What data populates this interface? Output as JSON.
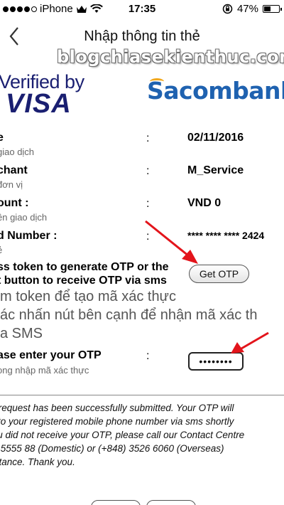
{
  "status_bar": {
    "carrier": "iPhone",
    "time": "17:35",
    "battery_percent": "47%",
    "battery_level": 0.47,
    "signal_dots_filled": 4,
    "signal_dots_total": 5
  },
  "nav": {
    "title": "Nhập thông tin thẻ",
    "watermark": "blogchiasekienthuc.com"
  },
  "logos": {
    "visa_line1": "Verified by",
    "visa_line2": "VISA",
    "bank": "Sacombank"
  },
  "form": {
    "rows": [
      {
        "label": "e",
        "sublabel": "giao dịch",
        "colon": ":",
        "value": "02/11/2016"
      },
      {
        "label": "chant",
        "sublabel": "đơn vị",
        "colon": ":",
        "value": "M_Service"
      },
      {
        "label": "ount :",
        "sublabel": "ền giao dịch",
        "colon": ":",
        "value": "VND 0"
      },
      {
        "label": "d Number :",
        "sublabel": "ẻ",
        "colon": ":",
        "value": "**** **** **** 2424"
      }
    ],
    "otp_prompt_line1": "ss token to generate OTP or the",
    "otp_prompt_line2": "t button to receive OTP via sms",
    "get_otp_label": "Get OTP",
    "otp_prompt_vi_line1": "m token để tạo mã xác thực",
    "otp_prompt_vi_line2": "ác nhấn nút bên cạnh để nhận mã xác th",
    "otp_prompt_vi_line3": "a SMS",
    "enter_otp_label": "ase enter your OTP",
    "enter_otp_sublabel": "ong nhập mã xác thực",
    "enter_otp_colon": ":",
    "otp_value": "••••••••"
  },
  "message": {
    "line1": "ur request has been successfully submitted. Your OTP will",
    "line2": "nt to your registered mobile phone number via sms shortly",
    "line3": "you did not receive your OTP, please call our Contact Centre",
    "line4": "00 5555 88 (Domestic) or (+848) 3526 6060 (Overseas)",
    "line5": "sistance. Thank you."
  },
  "colors": {
    "visa_blue": "#1a1f71",
    "sacombank_blue": "#1f62b0",
    "arrow_red": "#e3141b"
  }
}
